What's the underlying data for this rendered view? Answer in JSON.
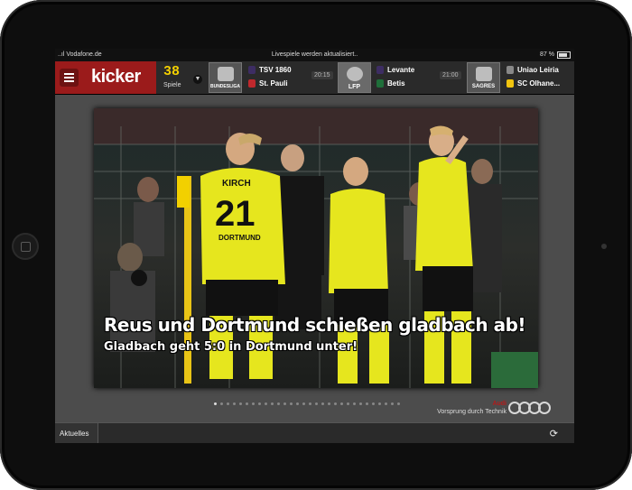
{
  "status_bar": {
    "carrier": "..ıl Vodafone.de",
    "message": "Livespiele werden aktualisiert..",
    "battery": "87 %"
  },
  "header": {
    "logo": "kicker",
    "games_count": "38",
    "games_label": "Spiele",
    "leagues": {
      "bundesliga": "BUNDESLIGA",
      "lfp": "LFP",
      "sagres": "SAGRES"
    },
    "matches": [
      {
        "home": "TSV 1860",
        "away": "St. Pauli",
        "time": "20:15"
      },
      {
        "home": "Levante",
        "away": "Betis",
        "time": "21:00"
      },
      {
        "home": "Uniao Leiria",
        "away": "SC Olhane..."
      }
    ]
  },
  "hero": {
    "headline": "Reus und Dortmund schießen gladbach ab!",
    "subline": "Gladbach geht 5:0 in Dortmund unter!",
    "jersey_name": "KIRCH",
    "jersey_number": "21",
    "jersey_sponsor": "DORTMUND"
  },
  "ad": {
    "brand": "Audi",
    "slogan": "Vorsprung durch Technik"
  },
  "bottom_bar": {
    "tab": "Aktuelles"
  },
  "pager": {
    "current": 0,
    "count": 30
  }
}
